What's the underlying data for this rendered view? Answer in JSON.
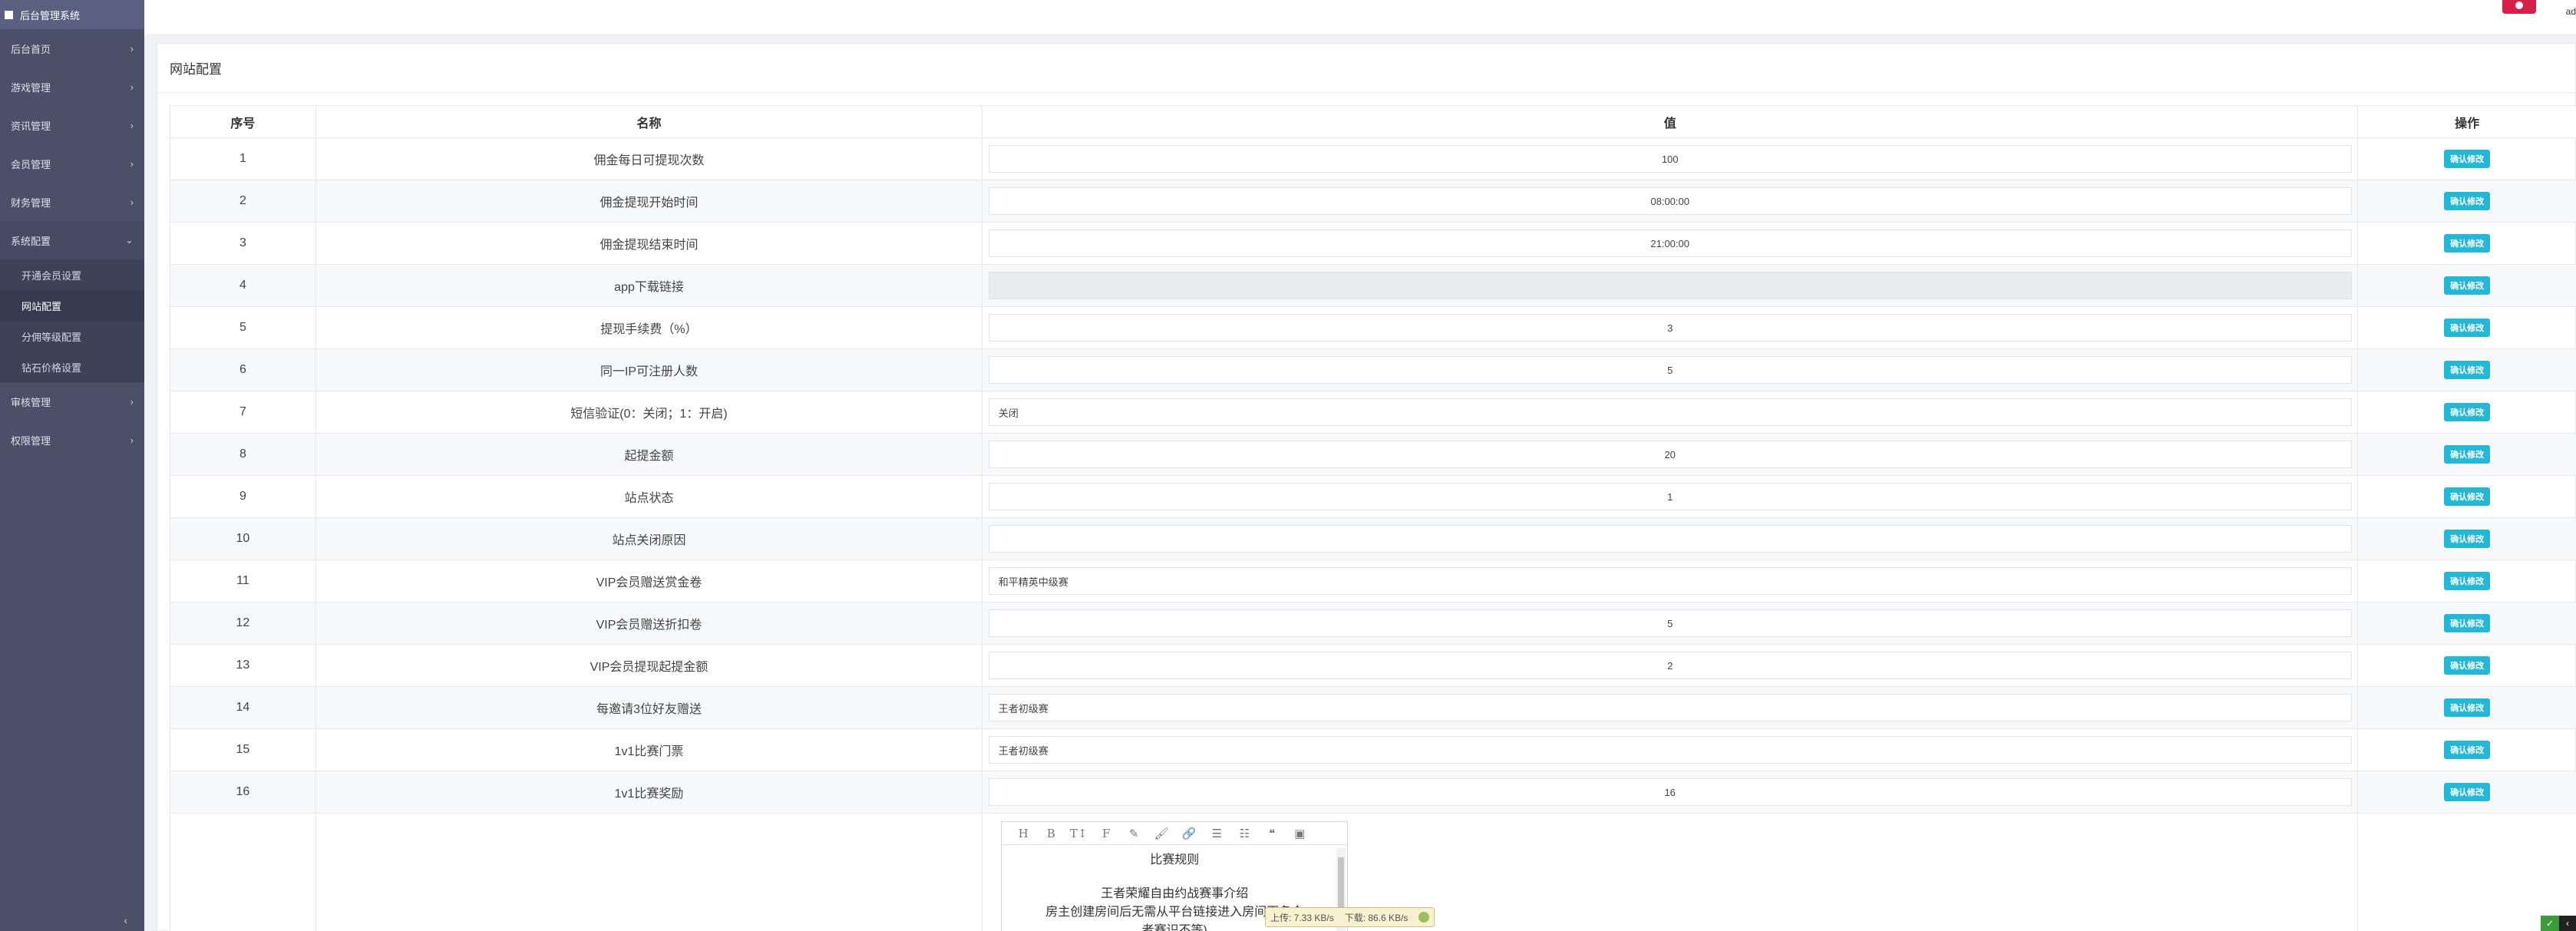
{
  "sidebar": {
    "brand": "后台管理系统",
    "menu": [
      {
        "label": "后台首页"
      },
      {
        "label": "游戏管理"
      },
      {
        "label": "资讯管理"
      },
      {
        "label": "会员管理"
      },
      {
        "label": "财务管理"
      },
      {
        "label": "系统配置"
      }
    ],
    "submenu": [
      {
        "label": "开通会员设置"
      },
      {
        "label": "网站配置"
      },
      {
        "label": "分佣等级配置"
      },
      {
        "label": "钻石价格设置"
      }
    ],
    "menu_after": [
      {
        "label": "审核管理"
      },
      {
        "label": "权限管理"
      }
    ],
    "arrow": "›",
    "open_arrow": "⌄",
    "collapse_arrow": "‹"
  },
  "topbar": {
    "admin_label": "ad"
  },
  "panel": {
    "title": "网站配置"
  },
  "table": {
    "headers": {
      "no": "序号",
      "name": "名称",
      "value": "值",
      "op": "操作"
    },
    "rows": [
      {
        "no": "1",
        "name": "佣金每日可提现次数",
        "value": "100",
        "op": "确认修改"
      },
      {
        "no": "2",
        "name": "佣金提现开始时间",
        "value": "08:00:00",
        "op": "确认修改"
      },
      {
        "no": "3",
        "name": "佣金提现结束时间",
        "value": "21:00:00",
        "op": "确认修改"
      },
      {
        "no": "4",
        "name": "app下载链接",
        "value": "",
        "op": "确认修改"
      },
      {
        "no": "5",
        "name": "提现手续费（%）",
        "value": "3",
        "op": "确认修改"
      },
      {
        "no": "6",
        "name": "同一IP可注册人数",
        "value": "5",
        "op": "确认修改"
      },
      {
        "no": "7",
        "name": "短信验证(0：关闭；1：开启)",
        "value": "关闭",
        "op": "确认修改"
      },
      {
        "no": "8",
        "name": "起提金额",
        "value": "20",
        "op": "确认修改"
      },
      {
        "no": "9",
        "name": "站点状态",
        "value": "1",
        "op": "确认修改"
      },
      {
        "no": "10",
        "name": "站点关闭原因",
        "value": "",
        "op": "确认修改"
      },
      {
        "no": "11",
        "name": "VIP会员赠送赏金卷",
        "value": "和平精英中级赛",
        "op": "确认修改"
      },
      {
        "no": "12",
        "name": "VIP会员赠送折扣卷",
        "value": "5",
        "op": "确认修改"
      },
      {
        "no": "13",
        "name": "VIP会员提现起提金额",
        "value": "2",
        "op": "确认修改"
      },
      {
        "no": "14",
        "name": "每邀请3位好友赠送",
        "value": "王者初级赛",
        "op": "确认修改"
      },
      {
        "no": "15",
        "name": "1v1比赛门票",
        "value": "王者初级赛",
        "op": "确认修改"
      },
      {
        "no": "16",
        "name": "1v1比赛奖励",
        "value": "16",
        "op": "确认修改"
      }
    ]
  },
  "editor": {
    "toolbar": [
      "H",
      "B",
      "T↕",
      "F",
      "✎",
      "🖌",
      "🔗",
      "☰",
      "☷",
      "❝",
      "▣"
    ],
    "lines": [
      "比赛规则",
      "",
      "王者荣耀自由约战赛事介绍",
      "房主创建房间后无需从平台链接进入房间百名会",
      "者赛识不等)"
    ]
  },
  "netspeed": {
    "up": "上传: 7.33 KB/s",
    "down": "下载: 86.6 KB/s"
  },
  "corner": {
    "g": "✓",
    "b": "‹"
  }
}
